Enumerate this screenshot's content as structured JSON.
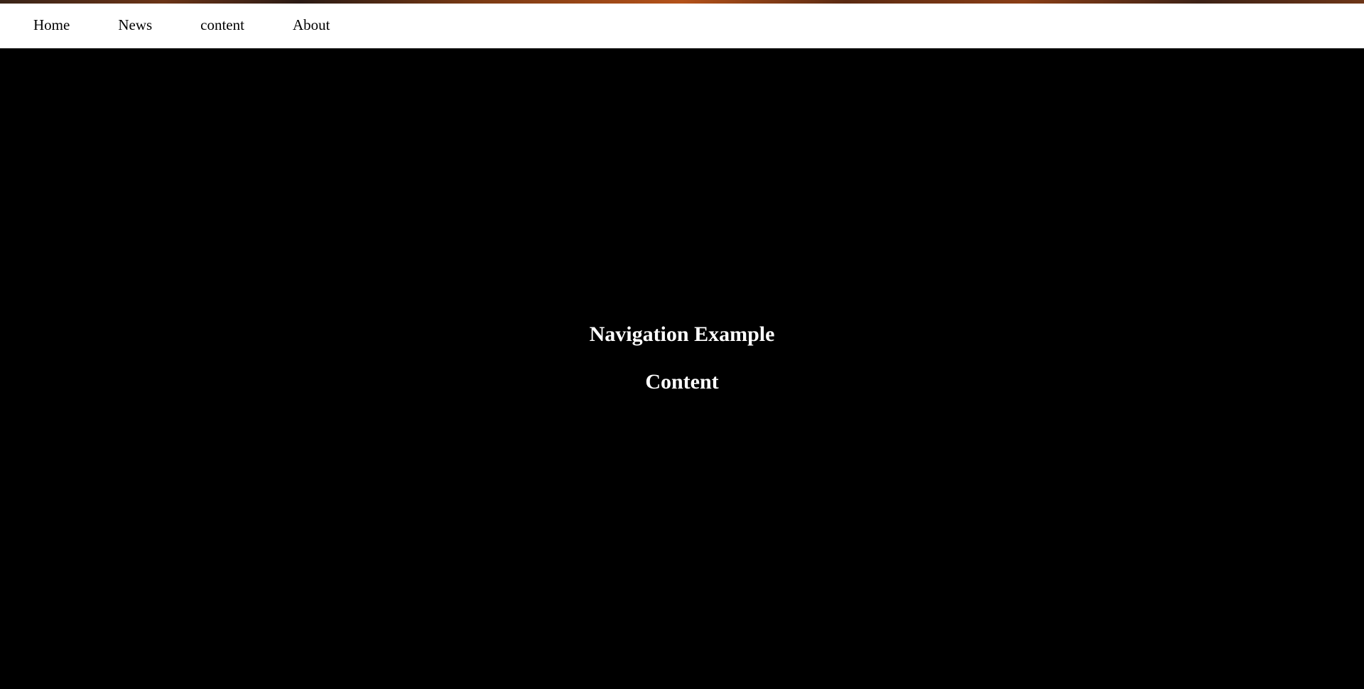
{
  "nav": {
    "items": [
      {
        "label": "Home"
      },
      {
        "label": "News"
      },
      {
        "label": "content"
      },
      {
        "label": "About"
      }
    ]
  },
  "main": {
    "title": "Navigation Example",
    "subtitle": "Content"
  },
  "colors": {
    "nav_background": "#ffffff",
    "page_background": "#000000",
    "heading_text": "#ffffff",
    "nav_text": "#000000"
  }
}
